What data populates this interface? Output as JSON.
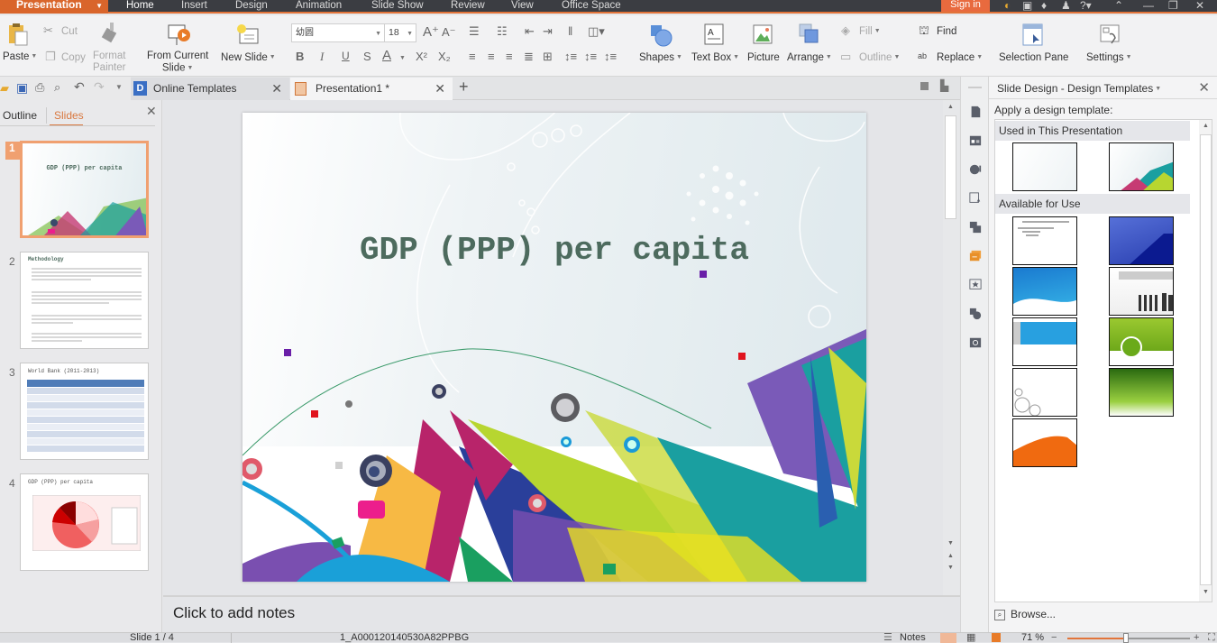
{
  "app": {
    "menu_button": "Presentation",
    "menu_tabs": [
      "Home",
      "Insert",
      "Design",
      "Animation",
      "Slide Show",
      "Review",
      "View",
      "Office Space"
    ],
    "active_tab": "Home",
    "sign_in": "Sign in"
  },
  "ribbon": {
    "paste": "Paste",
    "cut": "Cut",
    "copy": "Copy",
    "format_painter_1": "Format",
    "format_painter_2": "Painter",
    "from_current_1": "From Current",
    "from_current_2": "Slide",
    "new_slide": "New Slide",
    "font_name": "幼圆",
    "font_size": "18",
    "shapes": "Shapes",
    "text_box": "Text Box",
    "picture": "Picture",
    "arrange": "Arrange",
    "fill": "Fill",
    "outline": "Outline",
    "find": "Find",
    "replace": "Replace",
    "selection_pane": "Selection Pane",
    "settings": "Settings"
  },
  "doc_tabs": [
    {
      "label": "Online Templates",
      "active": false
    },
    {
      "label": "Presentation1 *",
      "active": true
    }
  ],
  "left_panel": {
    "tabs": [
      "Outline",
      "Slides"
    ],
    "active_tab": "Slides",
    "slides": [
      {
        "number": "1",
        "title": "GDP (PPP) per capita"
      },
      {
        "number": "2",
        "title": "Methodology"
      },
      {
        "number": "3",
        "title": "World Bank (2011-2013)"
      },
      {
        "number": "4",
        "title": "GDP (PPP) per capita"
      }
    ]
  },
  "slide": {
    "title": "GDP (PPP) per capita"
  },
  "notes": {
    "placeholder": "Click to add notes"
  },
  "task_pane": {
    "title": "Slide Design - Design Templates",
    "subtitle": "Apply a design template:",
    "group_used": "Used in This Presentation",
    "group_available": "Available for Use",
    "browse": "Browse..."
  },
  "status": {
    "slide_counter": "Slide 1 / 4",
    "template_name": "1_A000120140530A82PPBG",
    "notes": "Notes",
    "zoom": "71 %",
    "zoom_level": 0.71
  },
  "colors": {
    "accent": "#e2743a",
    "title_text": "#4d6b5e"
  }
}
